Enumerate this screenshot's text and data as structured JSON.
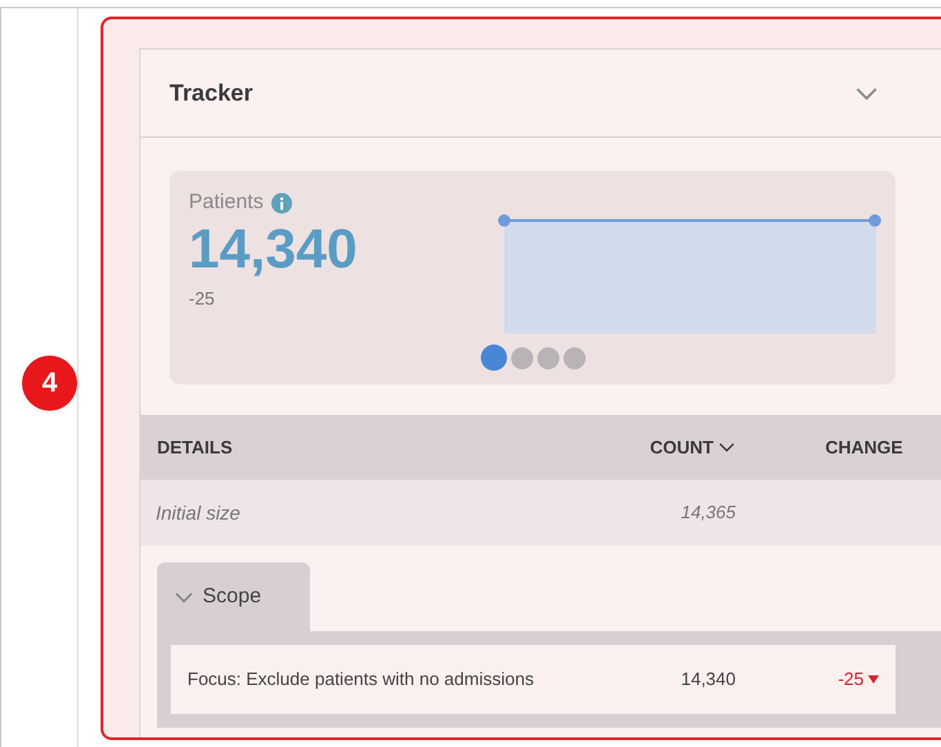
{
  "callout": {
    "number": "4"
  },
  "panel": {
    "title": "Tracker",
    "expanded": true
  },
  "metric": {
    "label": "Patients",
    "value": "14,340",
    "change": "-25"
  },
  "carousel": [
    {
      "selected": true
    },
    {
      "selected": false
    },
    {
      "selected": false
    },
    {
      "selected": false
    }
  ],
  "table": {
    "columns": [
      {
        "label": "DETAILS",
        "sorted": false
      },
      {
        "label": "COUNT",
        "sorted": true
      },
      {
        "label": "CHANGE",
        "sorted": false
      }
    ],
    "rows": [
      {
        "label": "Initial size",
        "count": "14,365"
      }
    ]
  },
  "scope": {
    "title": "Scope",
    "expanded": true,
    "items": [
      {
        "label": "Focus: Exclude patients with no admissions",
        "count": "14,340",
        "change": "-25",
        "decreased": true
      }
    ]
  }
}
